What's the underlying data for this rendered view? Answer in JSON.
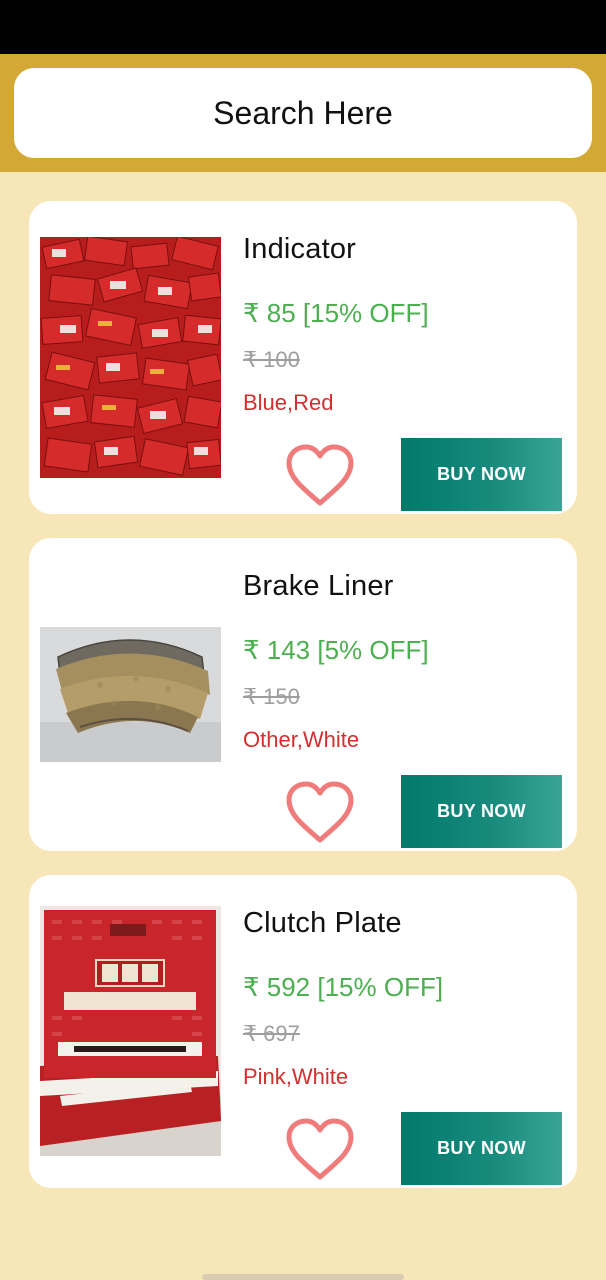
{
  "search": {
    "label": "Search Here"
  },
  "products": [
    {
      "title": "Indicator",
      "price": "₹ 85 [15% OFF]",
      "mrp": "₹ 100",
      "colors": "Blue,Red",
      "buy_label": "BUY NOW",
      "image": "indicator-boxes-image"
    },
    {
      "title": "Brake Liner",
      "price": "₹ 143 [5% OFF]",
      "mrp": "₹ 150",
      "colors": "Other,White",
      "buy_label": "BUY NOW",
      "image": "brake-liner-image"
    },
    {
      "title": "Clutch Plate",
      "price": "₹ 592 [15% OFF]",
      "mrp": "₹ 697",
      "colors": "Pink,White",
      "buy_label": "BUY NOW",
      "image": "clutch-plate-box-image"
    }
  ],
  "colors": {
    "header": "#d4a835",
    "background": "#f7e6b8",
    "price": "#4caf50",
    "color_text": "#d32f2f",
    "button": "#00796b",
    "heart": "#f07b7b"
  }
}
